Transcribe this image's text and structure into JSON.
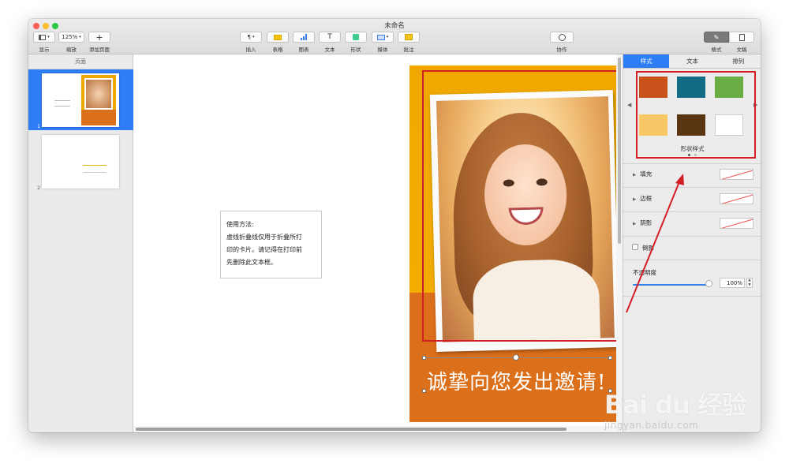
{
  "window": {
    "title": "未命名"
  },
  "toolbar": {
    "view": "显示",
    "zoom": "缩放",
    "zoom_value": "125%",
    "add_page": "添加页面",
    "insert": "插入",
    "table": "表格",
    "chart": "图表",
    "text": "文本",
    "shape": "形状",
    "media": "媒体",
    "comment": "批注",
    "collaborate": "协作",
    "format": "格式",
    "document": "文稿",
    "insert_glyph": "¶",
    "text_glyph": "T",
    "add_glyph": "+"
  },
  "sidebar": {
    "header": "页面",
    "pages": [
      {
        "number": "1"
      },
      {
        "number": "2"
      }
    ]
  },
  "canvas": {
    "note_lines": [
      "使用方法:",
      "虚线折叠线仅用于折叠所打",
      "印的卡片。请记得在打印前",
      "先删除此文本框。"
    ],
    "greeting": "诚挚向您发出邀请!"
  },
  "inspector": {
    "tabs": [
      "样式",
      "文本",
      "排列"
    ],
    "shape_styles_label": "形状样式",
    "style_colors": [
      "#c8521a",
      "#126c86",
      "#6aad45",
      "#f8c866",
      "#5a3512",
      "#ffffff"
    ],
    "fill": "填充",
    "border": "边框",
    "shadow": "阴影",
    "reflection": "倒影",
    "opacity": "不透明度",
    "opacity_value": "100%"
  },
  "watermark": {
    "logo": "Bai du 经验",
    "url": "jingyan.baidu.com"
  }
}
